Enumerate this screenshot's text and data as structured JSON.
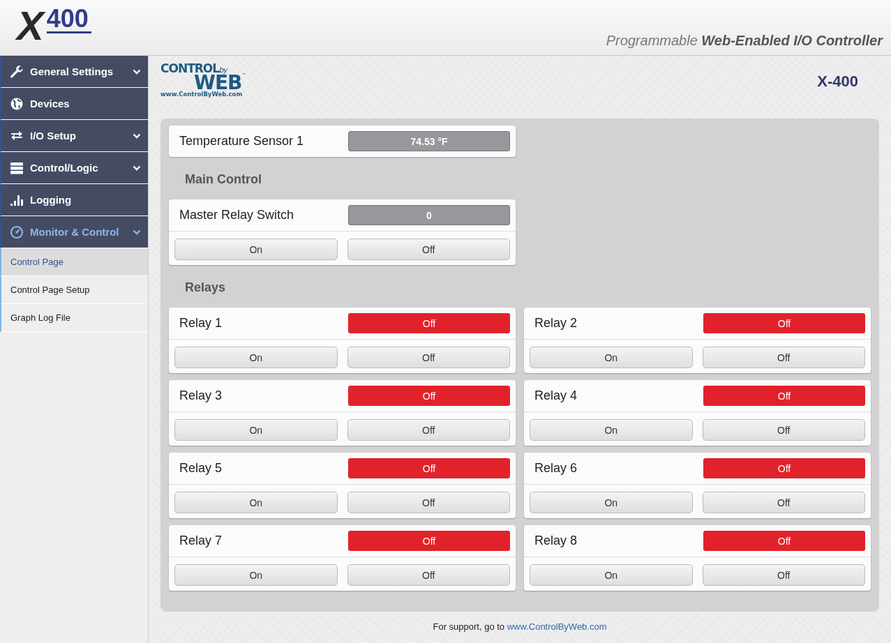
{
  "header": {
    "logo": {
      "letter": "X",
      "number": "400"
    },
    "tagline": "Programmable **Web-Enabled I/O Controller**"
  },
  "sidebar": {
    "items": [
      {
        "label": "General Settings",
        "has_submenu": true,
        "selected": false
      },
      {
        "label": "Devices",
        "has_submenu": false,
        "selected": false
      },
      {
        "label": "I/O Setup",
        "has_submenu": true,
        "selected": false
      },
      {
        "label": "Control/Logic",
        "has_submenu": true,
        "selected": false
      },
      {
        "label": "Logging",
        "has_submenu": false,
        "selected": false
      },
      {
        "label": "Monitor & Control",
        "has_submenu": true,
        "selected": true,
        "children": [
          {
            "label": "Control Page",
            "selected": true
          },
          {
            "label": "Control Page Setup",
            "selected": false
          },
          {
            "label": "Graph Log File",
            "selected": false
          }
        ]
      }
    ]
  },
  "brand": {
    "word1": "CONTROL",
    "word2": "by",
    "word3": "WEB",
    "mark": "™",
    "url": "www.ControlByWeb.com"
  },
  "device_name": "X-400",
  "sensor": {
    "label": "Temperature Sensor 1",
    "value": "74.53 °F"
  },
  "main_control": {
    "heading": "Main Control",
    "label": "Master Relay Switch",
    "value": "0",
    "on_button": "On",
    "off_button": "Off"
  },
  "relays": {
    "heading": "Relays",
    "items": [
      {
        "label": "Relay 1",
        "value": "Off",
        "on": false,
        "on_button": "On",
        "off_button": "Off"
      },
      {
        "label": "Relay 2",
        "value": "Off",
        "on": false,
        "on_button": "On",
        "off_button": "Off"
      },
      {
        "label": "Relay 3",
        "value": "Off",
        "on": false,
        "on_button": "On",
        "off_button": "Off"
      },
      {
        "label": "Relay 4",
        "value": "Off",
        "on": false,
        "on_button": "On",
        "off_button": "Off"
      },
      {
        "label": "Relay 5",
        "value": "Off",
        "on": false,
        "on_button": "On",
        "off_button": "Off"
      },
      {
        "label": "Relay 6",
        "value": "Off",
        "on": false,
        "on_button": "On",
        "off_button": "Off"
      },
      {
        "label": "Relay 7",
        "value": "Off",
        "on": false,
        "on_button": "On",
        "off_button": "Off"
      },
      {
        "label": "Relay 8",
        "value": "Off",
        "on": false,
        "on_button": "On",
        "off_button": "Off"
      }
    ]
  },
  "footer": {
    "text": "For support, go to",
    "link": "www.ControlByWeb.com"
  }
}
